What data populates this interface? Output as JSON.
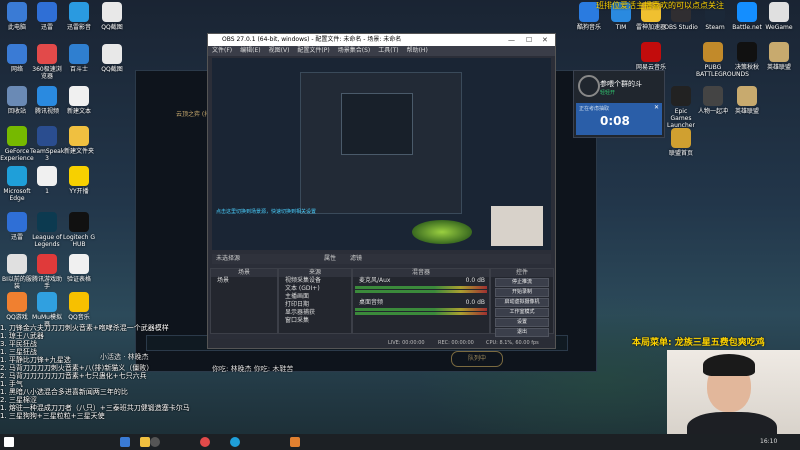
{
  "desktop_icons_left": [
    {
      "label": "此电脑",
      "color": "#3a7bd5"
    },
    {
      "label": "迅雷",
      "color": "#2f6fd6"
    },
    {
      "label": "迅雷影音",
      "color": "#2a9ae0"
    },
    {
      "label": "QQ截图",
      "color": "#e8e8e8"
    },
    {
      "label": "网络",
      "color": "#3a7bd5"
    },
    {
      "label": "360极速浏览器",
      "color": "#e24a4a"
    },
    {
      "label": "百斗士",
      "color": "#2f7fd0"
    },
    {
      "label": "QQ截图",
      "color": "#e8e8e8"
    },
    {
      "label": "回收站",
      "color": "#6a8ab5"
    },
    {
      "label": "腾讯视频",
      "color": "#2a8ae0"
    },
    {
      "label": "新建文本",
      "color": "#f0f0f0"
    },
    {
      "label": "GeForce Experience",
      "color": "#76b900"
    },
    {
      "label": "TeamSpeak 3",
      "color": "#2a4d8f"
    },
    {
      "label": "新建文件夹",
      "color": "#f0c040"
    },
    {
      "label": "Microsoft Edge",
      "color": "#1f9fd9"
    },
    {
      "label": "1",
      "color": "#f0f0f0"
    },
    {
      "label": "YY开播",
      "color": "#f7d000"
    },
    {
      "label": "迅雷",
      "color": "#2f6fd6"
    },
    {
      "label": "League of Legends",
      "color": "#0c3a50"
    },
    {
      "label": "Logitech G HUB",
      "color": "#111"
    },
    {
      "label": "BI以前的服装",
      "color": "#e0e0e0"
    },
    {
      "label": "腾讯游戏助手",
      "color": "#e03a3a"
    },
    {
      "label": "验证表格",
      "color": "#f0f0f0"
    },
    {
      "label": "QQ游戏",
      "color": "#f08030"
    },
    {
      "label": "MuMu模拟器",
      "color": "#30a0e0"
    },
    {
      "label": "QQ音乐",
      "color": "#f7c000"
    }
  ],
  "desktop_icons_right": [
    {
      "label": "酷狗音乐",
      "color": "#2a7be0"
    },
    {
      "label": "TIM",
      "color": "#2a8ae0"
    },
    {
      "label": "雷神加速器",
      "color": "#f0c030"
    },
    {
      "label": "OBS Studio",
      "color": "#302e31"
    },
    {
      "label": "Steam",
      "color": "#1b2838"
    },
    {
      "label": "Battle.net",
      "color": "#148eff"
    },
    {
      "label": "WeGame",
      "color": "#e0e0e0"
    },
    {
      "label": "网易云音乐",
      "color": "#c20c0c"
    },
    {
      "label": "PUBG BATTLEGROUNDS",
      "color": "#c28a2a"
    },
    {
      "label": "决策秋秋",
      "color": "#111"
    },
    {
      "label": "英雄联盟",
      "color": "#c8aa6e"
    },
    {
      "label": "Epic Games Launcher",
      "color": "#222"
    },
    {
      "label": "人物一起冲",
      "color": "#444"
    },
    {
      "label": "英雄联盟",
      "color": "#c8aa6e"
    },
    {
      "label": "联盟首页",
      "color": "#d0a030"
    }
  ],
  "game_client": {
    "title": "云顶之弈 (排位赛)",
    "queue_button": "队列中"
  },
  "obs": {
    "title": "OBS 27.0.1 (64-bit, windows) - 配置文件: 未命名 - 场景: 未命名",
    "menu": [
      "文件(F)",
      "编辑(E)",
      "视图(V)",
      "配置文件(P)",
      "场景集合(S)",
      "工具(T)",
      "帮助(H)"
    ],
    "preview_caption": "点击这里切换到场景源，快速切换到相关设置",
    "transition_bar": {
      "left": "未选择源",
      "props": "属性",
      "filters": "滤镜"
    },
    "docks": {
      "scenes": {
        "title": "场景",
        "items": [
          "场景"
        ]
      },
      "sources": {
        "title": "来源",
        "items": [
          "视频采集设备",
          "文本 (GDI+)",
          "主播画面",
          "打印日期",
          "显示器捕获",
          "窗口采集"
        ]
      },
      "mixer": {
        "title": "混音器",
        "items": [
          {
            "name": "麦克风/Aux",
            "db": "0.0 dB"
          },
          {
            "name": "桌面音频",
            "db": "0.0 dB"
          }
        ]
      },
      "controls": {
        "title": "控件",
        "buttons": [
          "停止推流",
          "开始录制",
          "启动虚拟摄像机",
          "工作室模式",
          "设置",
          "退出"
        ]
      }
    },
    "status": {
      "live": "LIVE: 00:00:00",
      "rec": "REC: 00:00:00",
      "cpu": "CPU: 8.1%, 60.00 fps"
    }
  },
  "widget": {
    "title": "参喂个群的斗",
    "subtitle": "轻轻开",
    "timer_label": "正在考虑抽取",
    "timer": "0:08",
    "close": "✕"
  },
  "marquee": "班排位爱活主播喜欢的可以点点关注",
  "bottom_menu": "本局菜单: 龙族三星五费包爽吃鸡",
  "subtitle_left": "小活选 · 林晚杰",
  "subtitle_mid": "你吃: 林晚杰  你吃: 木鞋苦",
  "chat_lines": [
    "1. 刀锋金六夫刀刀刀刺火音素+咆哮杀混一个武器模样",
    "1. 琼王八武器",
    "3. 平民狂战",
    "1. 三星狂战",
    "1. 平静比刀锋+九星选",
    "2. 马背刀刀刀刀刺火音素+八(排)新猫义（僵败）",
    "2. 马背刀刀刀刀刀刀音素+七只蛊化+七只六兵",
    "1. 手气",
    "1. 黑暗八小选混合多进喜新闻两三年的比",
    "2. 三星棉涩",
    "1. 熔驻一种混成刀刀者（八只）+三泰班共刀健锻造塞卡尔马",
    "1. 三星狗狗+三星粒粒+三星天使"
  ],
  "taskbar": {
    "time": "16:10"
  }
}
